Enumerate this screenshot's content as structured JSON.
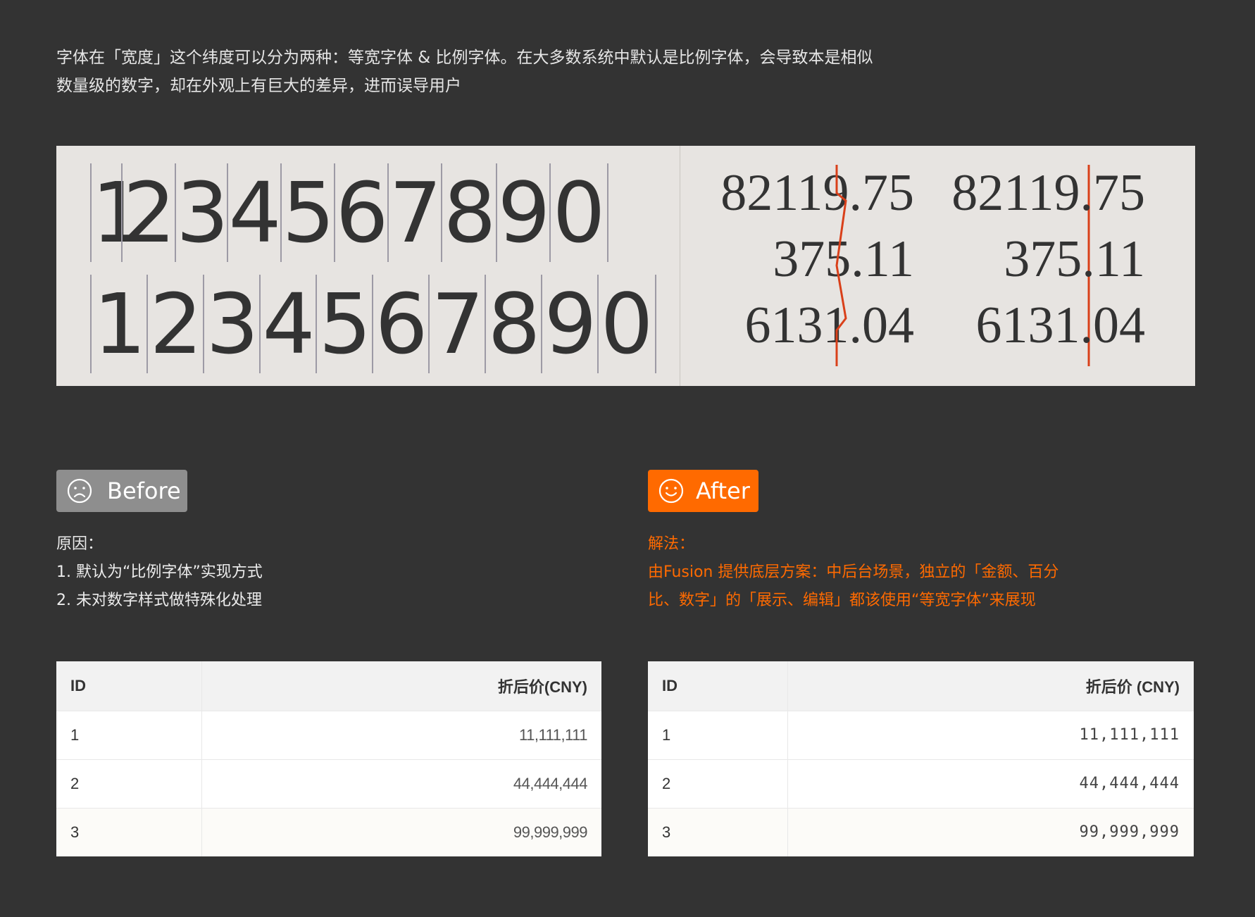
{
  "intro": {
    "line1": "字体在「宽度」这个纬度可以分为两种：等宽字体 & 比例字体。在大多数系统中默认是比例字体，会导致本是相似",
    "line2": "数量级的数字，却在外观上有巨大的差异，进而误导用户"
  },
  "illustration": {
    "proportional_digits": [
      "1",
      "2",
      "3",
      "4",
      "5",
      "6",
      "7",
      "8",
      "9",
      "0"
    ],
    "tabular_digits": [
      "1",
      "2",
      "3",
      "4",
      "5",
      "6",
      "7",
      "8",
      "9",
      "0"
    ],
    "numbers_left": [
      "82119.75",
      "375.11",
      "6131.04"
    ],
    "numbers_right": [
      "82119.75",
      "375.11",
      "6131.04"
    ],
    "guide_color": "#d9401a"
  },
  "before": {
    "tag_label": "Before",
    "tag_color": "#8e8e8e",
    "icon": "sad-face-icon",
    "notes_title": "原因：",
    "notes": [
      "1. 默认为“比例字体”实现方式",
      "2. 未对数字样式做特殊化处理"
    ],
    "table": {
      "headers": [
        "ID",
        "折后价(CNY)"
      ],
      "rows": [
        [
          "1",
          "11,111,111"
        ],
        [
          "2",
          "44,444,444"
        ],
        [
          "3",
          "99,999,999"
        ]
      ]
    }
  },
  "after": {
    "tag_label": "After",
    "tag_color": "#ff6a00",
    "icon": "smile-face-icon",
    "notes_title": "解法：",
    "notes": [
      "由Fusion 提供底层方案：中后台场景，独立的「金额、百分",
      "比、数字」的「展示、编辑」都该使用“等宽字体”来展现"
    ],
    "table": {
      "headers": [
        "ID",
        "折后价 (CNY)"
      ],
      "rows": [
        [
          "1",
          "11,111,111"
        ],
        [
          "2",
          "44,444,444"
        ],
        [
          "3",
          "99,999,999"
        ]
      ]
    }
  }
}
